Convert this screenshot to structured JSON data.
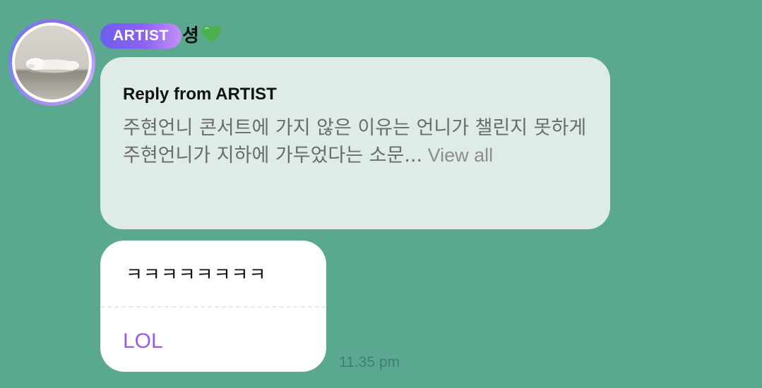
{
  "header": {
    "badge_label": "ARTIST",
    "nickname": "셩",
    "nickname_icon": "green-heart-icon"
  },
  "avatar": {
    "icon": "sleeping-dog-photo"
  },
  "reply": {
    "title": "Reply from ARTIST",
    "text": "주현언니 콘서트에 가지 않은 이유는 언니가 챌린지 못하게 주현언니가 지하에 가두었다는 소문...",
    "view_all": " View all"
  },
  "message": {
    "text": "ㅋㅋㅋㅋㅋㅋㅋㅋ",
    "translation": "LOL",
    "time": "11.35 pm"
  },
  "colors": {
    "background": "#5ba891",
    "reply_bubble": "#dfece6",
    "badge_start": "#6c5ef0",
    "badge_end": "#c68ff8",
    "translation": "#9b5ce0",
    "heart": "#4caf50"
  }
}
